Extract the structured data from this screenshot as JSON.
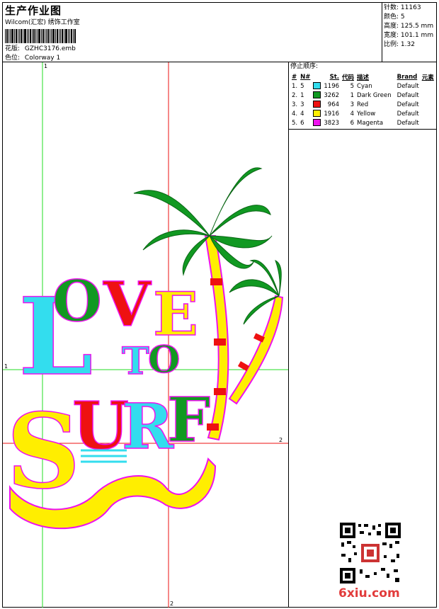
{
  "header": {
    "title": "生产作业图",
    "company": "Wilcom(汇宏) 绣饰工作室",
    "design_label": "花版:",
    "design_value": "GZHC3176.emb",
    "colorway_label": "色位:",
    "colorway_value": "Colorway 1"
  },
  "stats": [
    {
      "label": "针数:",
      "value": "11163"
    },
    {
      "label": "颜色:",
      "value": "5"
    },
    {
      "label": "高度:",
      "value": "125.5 mm"
    },
    {
      "label": "宽度:",
      "value": "101.1 mm"
    },
    {
      "label": "比例:",
      "value": "1.32"
    }
  ],
  "stop_sequence": {
    "title": "停止顺序:",
    "headers": [
      "#",
      "N#",
      "St.",
      "代码",
      "描述",
      "Brand",
      "元素"
    ],
    "rows": [
      {
        "idx": "1.",
        "n": "5",
        "color": "#33ddee",
        "st": "1196",
        "code": "5",
        "desc": "Cyan",
        "brand": "Default"
      },
      {
        "idx": "2.",
        "n": "1",
        "color": "#119922",
        "st": "3262",
        "code": "1",
        "desc": "Dark Green",
        "brand": "Default"
      },
      {
        "idx": "3.",
        "n": "3",
        "color": "#ee1111",
        "st": "964",
        "code": "3",
        "desc": "Red",
        "brand": "Default"
      },
      {
        "idx": "4.",
        "n": "4",
        "color": "#ffee00",
        "st": "1916",
        "code": "4",
        "desc": "Yellow",
        "brand": "Default"
      },
      {
        "idx": "5.",
        "n": "6",
        "color": "#ee11ee",
        "st": "3823",
        "code": "6",
        "desc": "Magenta",
        "brand": "Default"
      }
    ]
  },
  "guides": {
    "v1_label": "1",
    "h1_label": "1",
    "v2_label": "2",
    "h2_label": "2"
  },
  "watermark": "6xiu.com",
  "colors": {
    "cyan": "#33ddee",
    "green": "#119922",
    "red": "#ee1111",
    "yellow": "#ffee00",
    "magenta": "#ee11ee",
    "guide_green": "#22dd22",
    "guide_red": "#ee1111"
  }
}
